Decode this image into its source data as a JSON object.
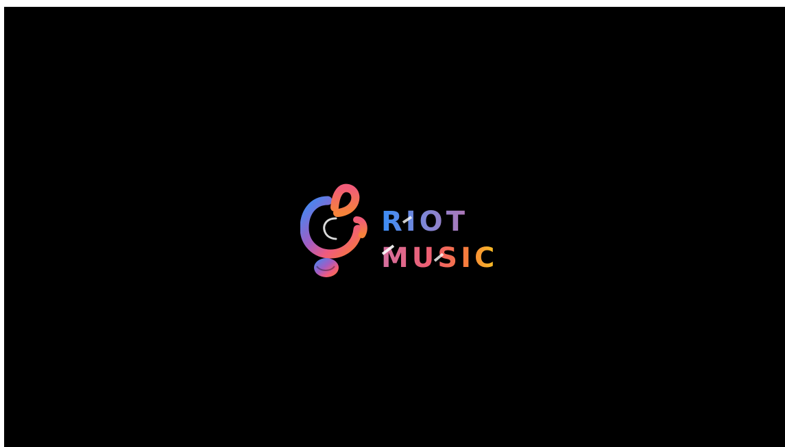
{
  "splash": {
    "logo": {
      "word1": "RIOT",
      "word2": "MUSIC",
      "icon": "treble-clef-note-icon"
    }
  },
  "colors": {
    "background": "#000000",
    "gradient_blue": "#3a8df6",
    "gradient_purple": "#9b5fc0",
    "gradient_pink": "#ec5d8a",
    "gradient_orange": "#f7703a",
    "gradient_yellow": "#f9c623"
  }
}
